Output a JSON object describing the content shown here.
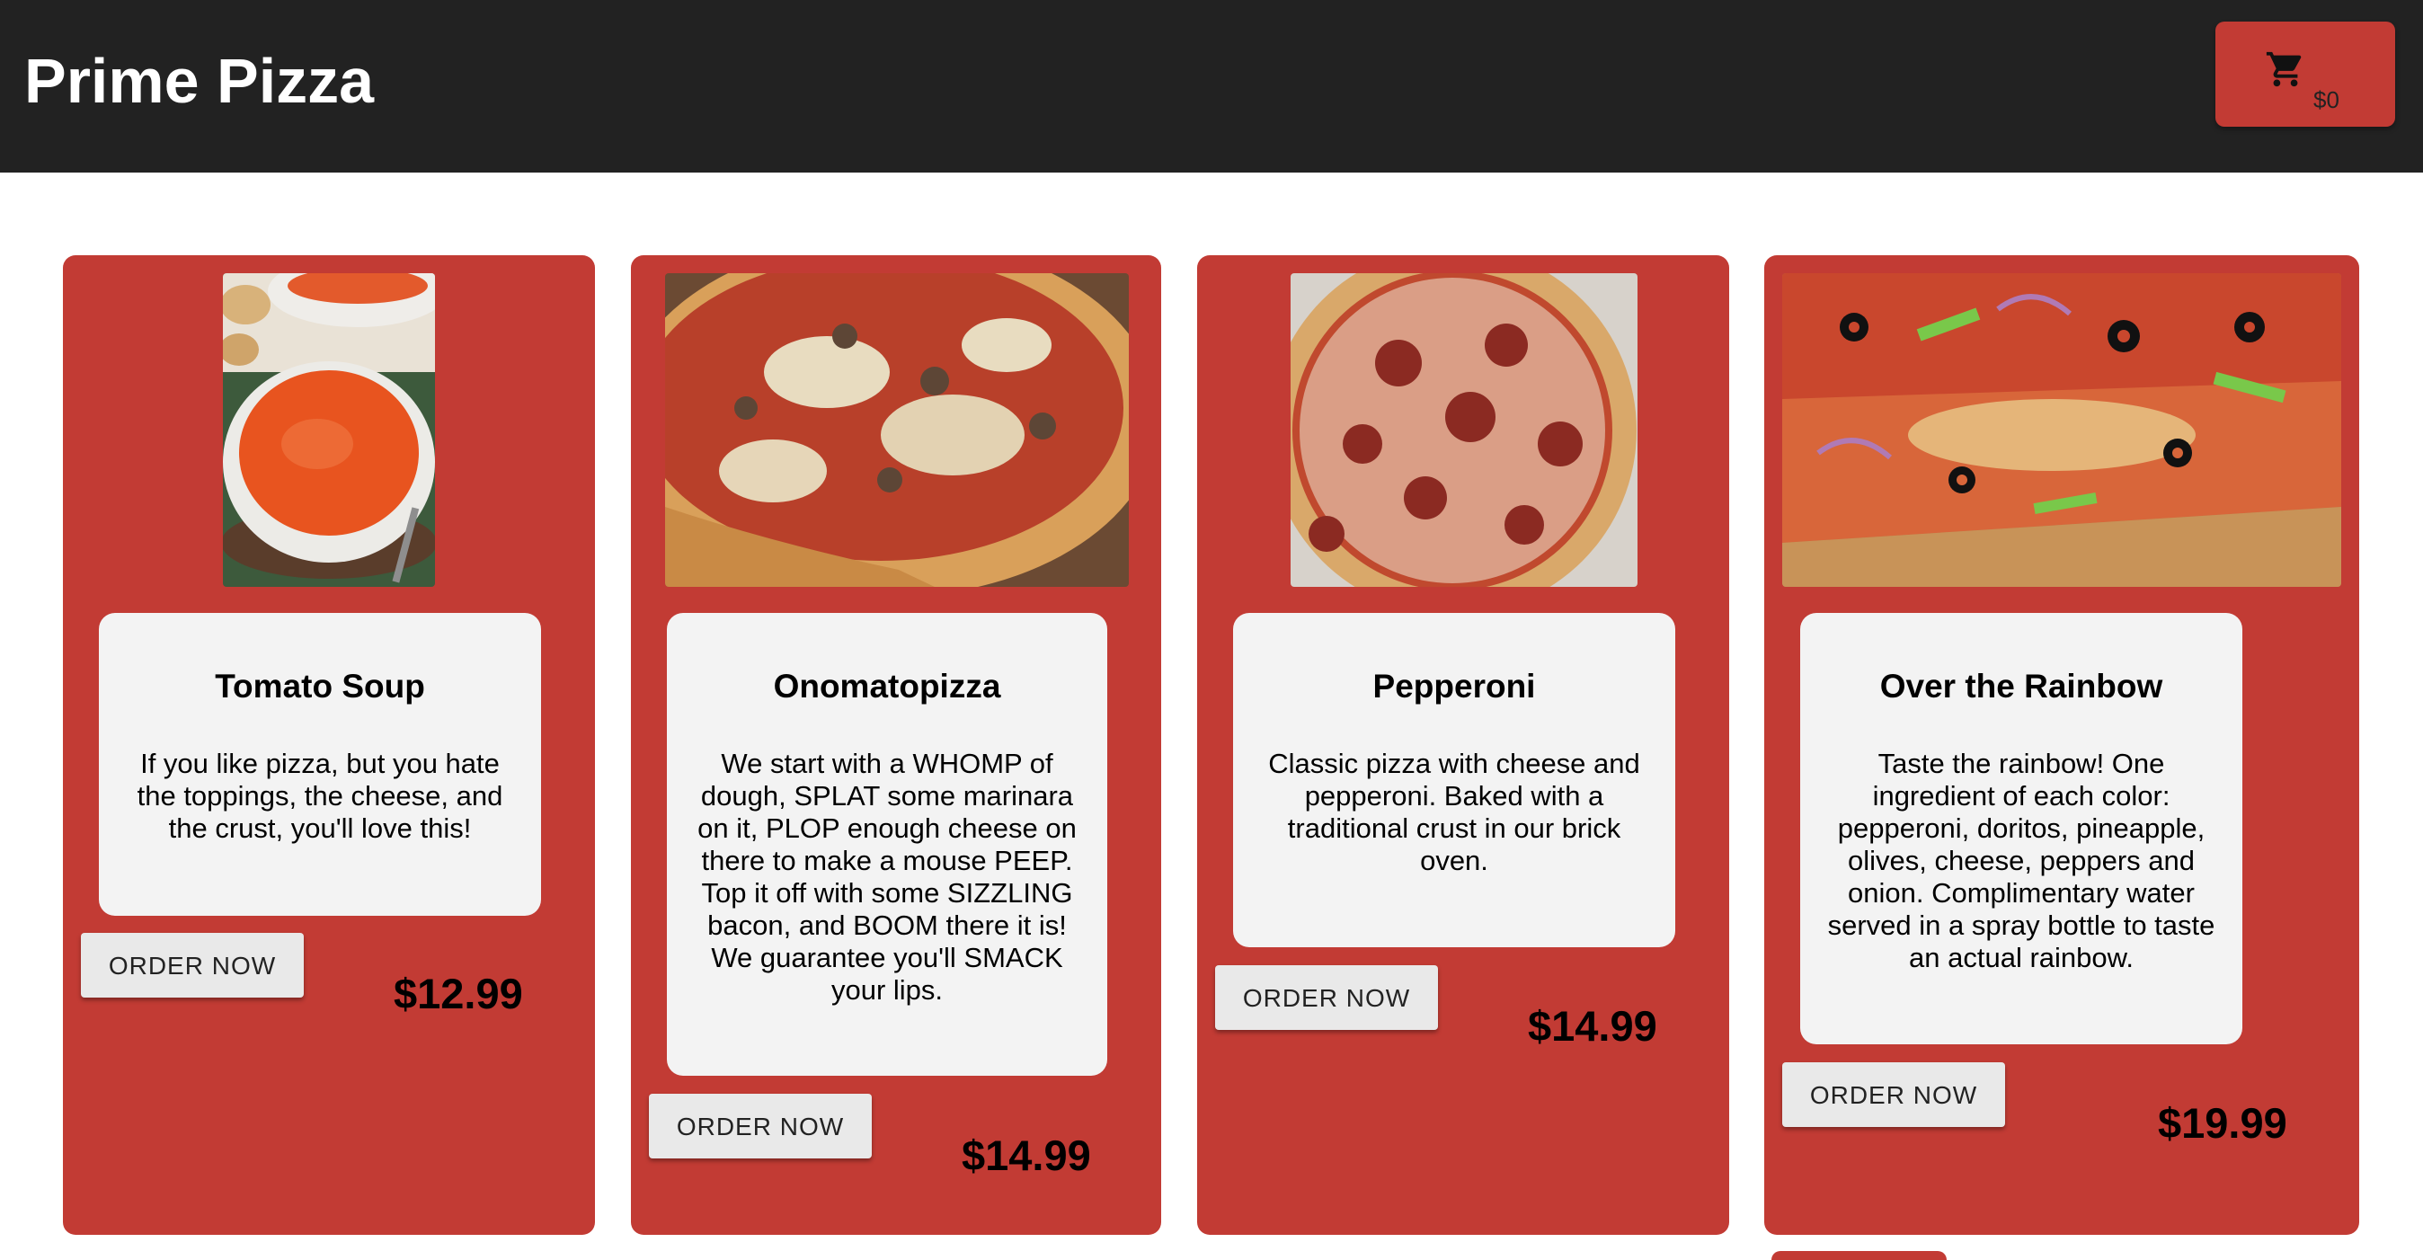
{
  "header": {
    "brand": "Prime Pizza",
    "cart_total": "$0",
    "cart_icon": "shopping-cart-icon"
  },
  "colors": {
    "header_bg": "#222222",
    "accent": "#c23b34",
    "info_bg": "#f3f3f3",
    "button_bg": "#e9e9e9"
  },
  "menu": {
    "items": [
      {
        "title": "Tomato Soup",
        "description": "If you like pizza, but you hate the toppings, the cheese, and the crust, you'll love this!",
        "button_label": "ORDER NOW",
        "price": "$12.99",
        "image": "tomato-soup-photo"
      },
      {
        "title": "Onomatopizza",
        "description": "We start with a WHOMP of dough, SPLAT some marinara on it, PLOP enough cheese on there to make a mouse PEEP. Top it off with some SIZZLING bacon, and BOOM there it is! We guarantee you'll SMACK your lips.",
        "button_label": "ORDER NOW",
        "price": "$14.99",
        "image": "mushroom-pizza-photo"
      },
      {
        "title": "Pepperoni",
        "description": "Classic pizza with cheese and pepperoni. Baked with a traditional crust in our brick oven.",
        "button_label": "ORDER NOW",
        "price": "$14.99",
        "image": "pepperoni-pizza-photo"
      },
      {
        "title": "Over the Rainbow",
        "description": "Taste the rainbow! One ingredient of each color: pepperoni, doritos, pineapple, olives, cheese, peppers and onion. Complimentary water served in a spray bottle to taste an actual rainbow.",
        "button_label": "ORDER NOW",
        "price": "$19.99",
        "image": "supreme-pizza-photo"
      }
    ]
  }
}
